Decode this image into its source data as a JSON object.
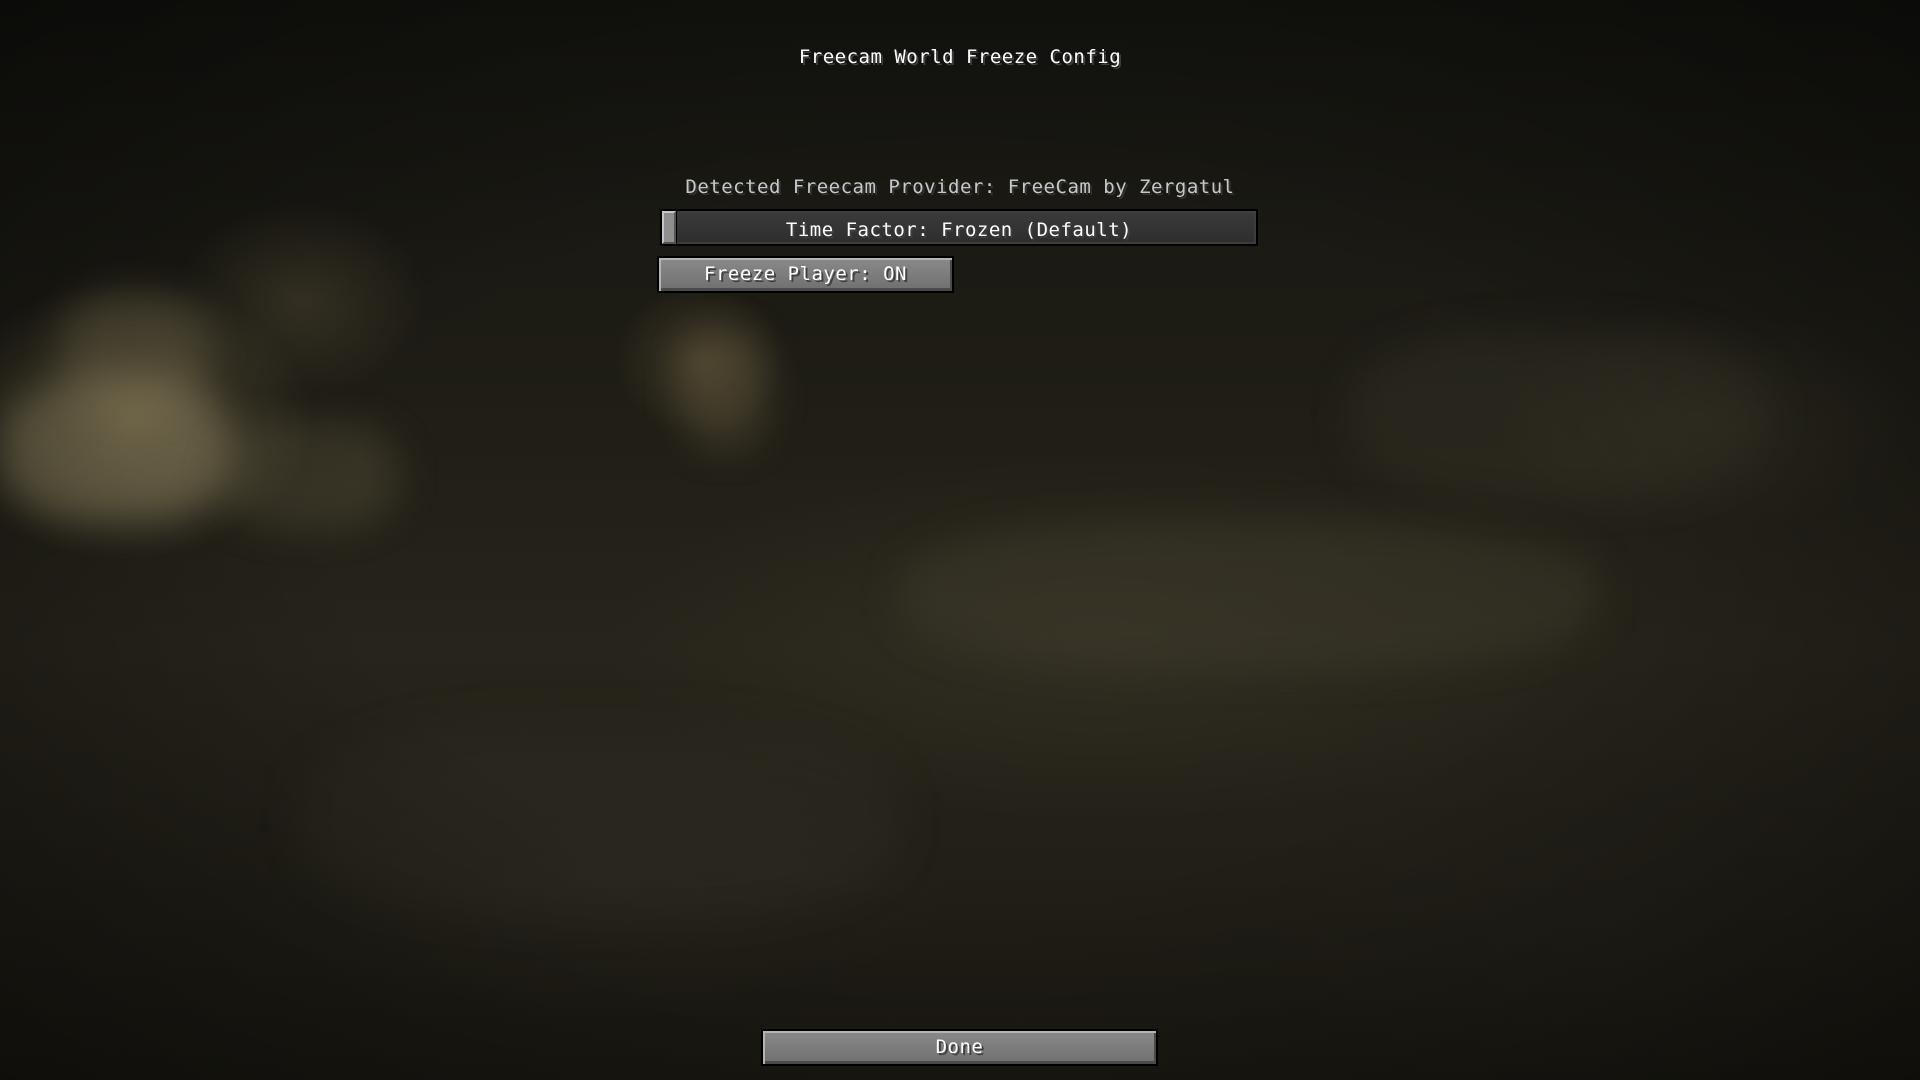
{
  "screen": {
    "title": "Freecam World Freeze Config"
  },
  "provider": {
    "label": "Detected Freecam Provider: FreeCam by Zergatul"
  },
  "time_factor_slider": {
    "label": "Time Factor: Frozen (Default)",
    "value_fraction": 0.0
  },
  "freeze_player_button": {
    "label": "Freeze Player: ON"
  },
  "done_button": {
    "label": "Done"
  },
  "colors": {
    "text": "#ffffff",
    "subtext": "#c8c8c8",
    "button_face": "#7c7c7c",
    "slider_track": "#333333"
  }
}
